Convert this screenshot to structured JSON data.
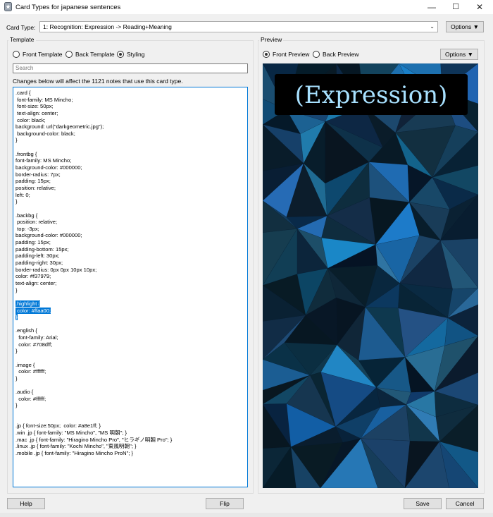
{
  "window": {
    "title": "Card Types for japanese sentences",
    "controls": {
      "minimize": "—",
      "maximize": "☐",
      "close": "✕"
    }
  },
  "card_type": {
    "label": "Card Type:",
    "selected": "1: Recognition: Expression -> Reading+Meaning",
    "options_label": "Options ▼"
  },
  "template": {
    "group_label": "Template",
    "radios": [
      {
        "label": "Front Template",
        "checked": false
      },
      {
        "label": "Back Template",
        "checked": false
      },
      {
        "label": "Styling",
        "checked": true
      }
    ],
    "search_placeholder": "Search",
    "info": "Changes below will affect the 1121 notes that use this card type.",
    "code_lines": [
      ".card {",
      " font-family: MS Mincho;",
      " font-size: 50px;",
      " text-align: center;",
      " color: black;",
      "background: url(\"darkgeometric.jpg\");",
      " background-color: black;",
      "}",
      "",
      ".frontbg {",
      "font-family: MS Mincho;",
      "background-color: #000000;",
      "border-radius: 7px;",
      "padding: 15px;",
      "position: relative;",
      "left: 0;",
      "}",
      "",
      ".backbg {",
      " position: relative;",
      " top: -3px;",
      "background-color: #000000;",
      "padding: 15px;",
      "padding-bottom: 15px;",
      "padding-left: 30px;",
      "padding-right: 30px;",
      "border-radius: 0px 0px 10px 10px;",
      "color: #f37979;",
      "text-align: center;",
      "}",
      "",
      ".highlight {",
      " color: #ffaa00;",
      "}",
      "",
      ".english {",
      "  font-family: Arial;",
      "  color: #708dff;",
      "}",
      "",
      ".image {",
      "  color: #ffffff;",
      "}",
      "",
      ".audio {",
      "  color: #ffffff;",
      "}",
      "",
      "",
      ".jp { font-size:50px;  color: #a8e1ff; }",
      ".win .jp { font-family: \"MS Mincho\", \"MS 明朝\"; }",
      ".mac .jp { font-family: \"Hiragino Mincho Pro\", \"ヒラギノ明朝 Pro\"; }",
      ".linux .jp { font-family: \"Kochi Mincho\", \"東風明朝\"; }",
      ".mobile .jp { font-family: \"Hiragino Mincho ProN\"; }"
    ],
    "selected_lines": [
      31,
      32,
      33
    ]
  },
  "preview": {
    "group_label": "Preview",
    "radios": [
      {
        "label": "Front Preview",
        "checked": true
      },
      {
        "label": "Back Preview",
        "checked": false
      }
    ],
    "options_label": "Options ▼",
    "card_text": "(Expression)",
    "text_color": "#a8e1ff"
  },
  "footer": {
    "help": "Help",
    "flip": "Flip",
    "save": "Save",
    "cancel": "Cancel"
  },
  "colors": {
    "selection": "#0078d7",
    "dialog_bg": "#f0f0f0"
  }
}
